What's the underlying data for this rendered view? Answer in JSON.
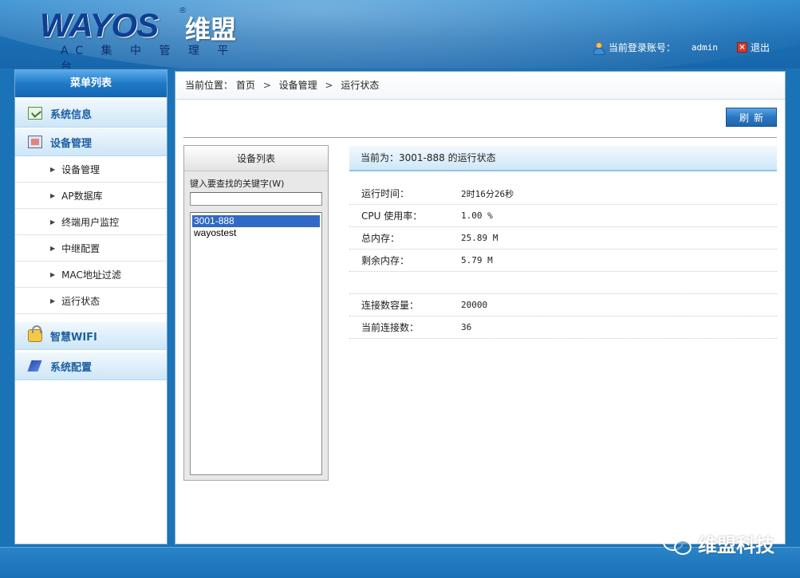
{
  "header": {
    "logo_main": "WAYOS",
    "logo_reg": "®",
    "logo_cn": "维盟",
    "logo_sub": "AC 集 中 管 理 平 台",
    "login_label": "当前登录账号：",
    "user": "admin",
    "logout_label": "退出"
  },
  "sidebar": {
    "title": "菜单列表",
    "groups": [
      {
        "label": "系统信息",
        "icon": "info-check-icon"
      },
      {
        "label": "设备管理",
        "icon": "device-icon",
        "items": [
          "设备管理",
          "AP数据库",
          "终端用户监控",
          "中继配置",
          "MAC地址过滤",
          "运行状态"
        ]
      },
      {
        "label": "智慧WIFI",
        "icon": "lock-icon"
      },
      {
        "label": "系统配置",
        "icon": "config-icon"
      }
    ]
  },
  "breadcrumb": {
    "label": "当前位置：",
    "items": [
      "首页",
      "设备管理",
      "运行状态"
    ],
    "separator": ">"
  },
  "toolbar": {
    "refresh_label": "刷新"
  },
  "device_panel": {
    "title": "设备列表",
    "search_label": "键入要查找的关键字(W)",
    "search_value": "",
    "devices": [
      "3001-888",
      "wayostest"
    ],
    "selected_index": 0
  },
  "status": {
    "header": "当前为：3001-888 的运行状态",
    "rows": [
      {
        "key": "运行时间：",
        "value": "2时16分26秒"
      },
      {
        "key": "CPU 使用率：",
        "value": "1.00 %"
      },
      {
        "key": "总内存：",
        "value": "25.89 M"
      },
      {
        "key": "剩余内存：",
        "value": "5.79 M"
      },
      {
        "key": "",
        "value": ""
      },
      {
        "key": "连接数容量：",
        "value": "20000"
      },
      {
        "key": "当前连接数：",
        "value": "36"
      }
    ]
  },
  "watermark": {
    "text": "维盟科技",
    "icon": "wechat-icon"
  },
  "colors": {
    "primary_blue": "#1b6fb5",
    "menu_text": "#1d5fa4",
    "selected_bg": "#3169c6"
  }
}
